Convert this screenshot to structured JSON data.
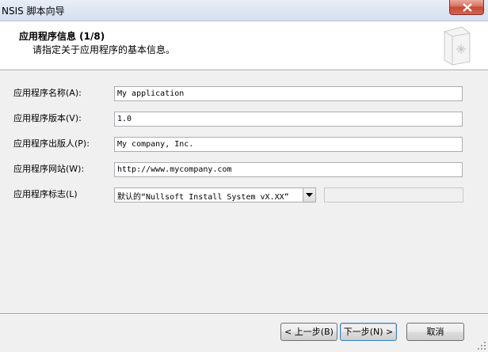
{
  "window": {
    "title": "NSIS 脚本向导",
    "close_icon": "close-icon"
  },
  "header": {
    "title": "应用程序信息 (1/8)",
    "subtitle": "请指定关于应用程序的基本信息。",
    "icon": "book-icon"
  },
  "form": {
    "name_label": "应用程序名称(A):",
    "name_value": "My application",
    "version_label": "应用程序版本(V):",
    "version_value": "1.0",
    "publisher_label": "应用程序出版人(P):",
    "publisher_value": "My company, Inc.",
    "website_label": "应用程序网站(W):",
    "website_value": "http://www.mycompany.com",
    "logo_label": "应用程序标志(L)",
    "logo_selected": "默认的“Nullsoft Install System vX.XX”",
    "logo_path_value": ""
  },
  "footer": {
    "back_label": "< 上一步(B)",
    "next_label": "下一步(N) >",
    "cancel_label": "取消"
  },
  "colors": {
    "close_button": "#c44a35",
    "header_background": "#ffffff",
    "window_background": "#f0f0f0"
  }
}
